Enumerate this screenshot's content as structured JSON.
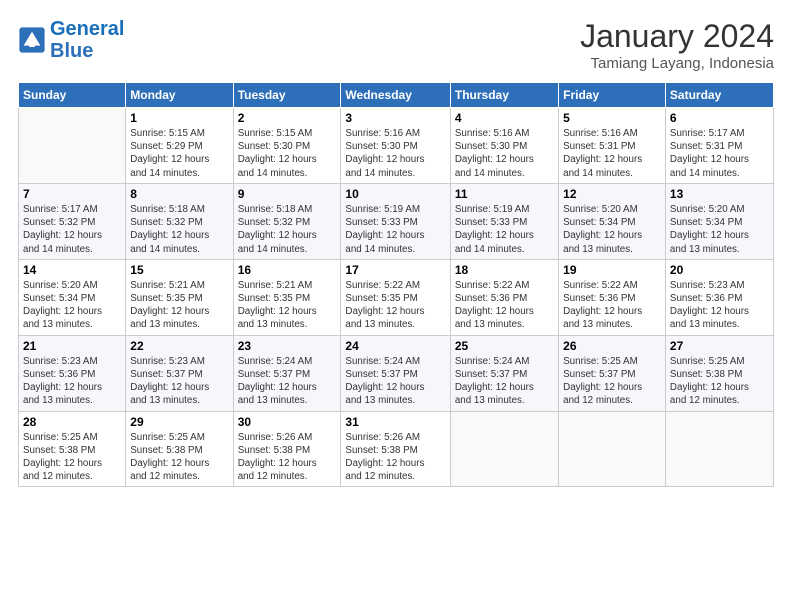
{
  "header": {
    "logo_line1": "General",
    "logo_line2": "Blue",
    "month_year": "January 2024",
    "location": "Tamiang Layang, Indonesia"
  },
  "weekdays": [
    "Sunday",
    "Monday",
    "Tuesday",
    "Wednesday",
    "Thursday",
    "Friday",
    "Saturday"
  ],
  "weeks": [
    [
      {
        "day": "",
        "info": ""
      },
      {
        "day": "1",
        "info": "Sunrise: 5:15 AM\nSunset: 5:29 PM\nDaylight: 12 hours\nand 14 minutes."
      },
      {
        "day": "2",
        "info": "Sunrise: 5:15 AM\nSunset: 5:30 PM\nDaylight: 12 hours\nand 14 minutes."
      },
      {
        "day": "3",
        "info": "Sunrise: 5:16 AM\nSunset: 5:30 PM\nDaylight: 12 hours\nand 14 minutes."
      },
      {
        "day": "4",
        "info": "Sunrise: 5:16 AM\nSunset: 5:30 PM\nDaylight: 12 hours\nand 14 minutes."
      },
      {
        "day": "5",
        "info": "Sunrise: 5:16 AM\nSunset: 5:31 PM\nDaylight: 12 hours\nand 14 minutes."
      },
      {
        "day": "6",
        "info": "Sunrise: 5:17 AM\nSunset: 5:31 PM\nDaylight: 12 hours\nand 14 minutes."
      }
    ],
    [
      {
        "day": "7",
        "info": "Sunrise: 5:17 AM\nSunset: 5:32 PM\nDaylight: 12 hours\nand 14 minutes."
      },
      {
        "day": "8",
        "info": "Sunrise: 5:18 AM\nSunset: 5:32 PM\nDaylight: 12 hours\nand 14 minutes."
      },
      {
        "day": "9",
        "info": "Sunrise: 5:18 AM\nSunset: 5:32 PM\nDaylight: 12 hours\nand 14 minutes."
      },
      {
        "day": "10",
        "info": "Sunrise: 5:19 AM\nSunset: 5:33 PM\nDaylight: 12 hours\nand 14 minutes."
      },
      {
        "day": "11",
        "info": "Sunrise: 5:19 AM\nSunset: 5:33 PM\nDaylight: 12 hours\nand 14 minutes."
      },
      {
        "day": "12",
        "info": "Sunrise: 5:20 AM\nSunset: 5:34 PM\nDaylight: 12 hours\nand 13 minutes."
      },
      {
        "day": "13",
        "info": "Sunrise: 5:20 AM\nSunset: 5:34 PM\nDaylight: 12 hours\nand 13 minutes."
      }
    ],
    [
      {
        "day": "14",
        "info": "Sunrise: 5:20 AM\nSunset: 5:34 PM\nDaylight: 12 hours\nand 13 minutes."
      },
      {
        "day": "15",
        "info": "Sunrise: 5:21 AM\nSunset: 5:35 PM\nDaylight: 12 hours\nand 13 minutes."
      },
      {
        "day": "16",
        "info": "Sunrise: 5:21 AM\nSunset: 5:35 PM\nDaylight: 12 hours\nand 13 minutes."
      },
      {
        "day": "17",
        "info": "Sunrise: 5:22 AM\nSunset: 5:35 PM\nDaylight: 12 hours\nand 13 minutes."
      },
      {
        "day": "18",
        "info": "Sunrise: 5:22 AM\nSunset: 5:36 PM\nDaylight: 12 hours\nand 13 minutes."
      },
      {
        "day": "19",
        "info": "Sunrise: 5:22 AM\nSunset: 5:36 PM\nDaylight: 12 hours\nand 13 minutes."
      },
      {
        "day": "20",
        "info": "Sunrise: 5:23 AM\nSunset: 5:36 PM\nDaylight: 12 hours\nand 13 minutes."
      }
    ],
    [
      {
        "day": "21",
        "info": "Sunrise: 5:23 AM\nSunset: 5:36 PM\nDaylight: 12 hours\nand 13 minutes."
      },
      {
        "day": "22",
        "info": "Sunrise: 5:23 AM\nSunset: 5:37 PM\nDaylight: 12 hours\nand 13 minutes."
      },
      {
        "day": "23",
        "info": "Sunrise: 5:24 AM\nSunset: 5:37 PM\nDaylight: 12 hours\nand 13 minutes."
      },
      {
        "day": "24",
        "info": "Sunrise: 5:24 AM\nSunset: 5:37 PM\nDaylight: 12 hours\nand 13 minutes."
      },
      {
        "day": "25",
        "info": "Sunrise: 5:24 AM\nSunset: 5:37 PM\nDaylight: 12 hours\nand 13 minutes."
      },
      {
        "day": "26",
        "info": "Sunrise: 5:25 AM\nSunset: 5:37 PM\nDaylight: 12 hours\nand 12 minutes."
      },
      {
        "day": "27",
        "info": "Sunrise: 5:25 AM\nSunset: 5:38 PM\nDaylight: 12 hours\nand 12 minutes."
      }
    ],
    [
      {
        "day": "28",
        "info": "Sunrise: 5:25 AM\nSunset: 5:38 PM\nDaylight: 12 hours\nand 12 minutes."
      },
      {
        "day": "29",
        "info": "Sunrise: 5:25 AM\nSunset: 5:38 PM\nDaylight: 12 hours\nand 12 minutes."
      },
      {
        "day": "30",
        "info": "Sunrise: 5:26 AM\nSunset: 5:38 PM\nDaylight: 12 hours\nand 12 minutes."
      },
      {
        "day": "31",
        "info": "Sunrise: 5:26 AM\nSunset: 5:38 PM\nDaylight: 12 hours\nand 12 minutes."
      },
      {
        "day": "",
        "info": ""
      },
      {
        "day": "",
        "info": ""
      },
      {
        "day": "",
        "info": ""
      }
    ]
  ]
}
